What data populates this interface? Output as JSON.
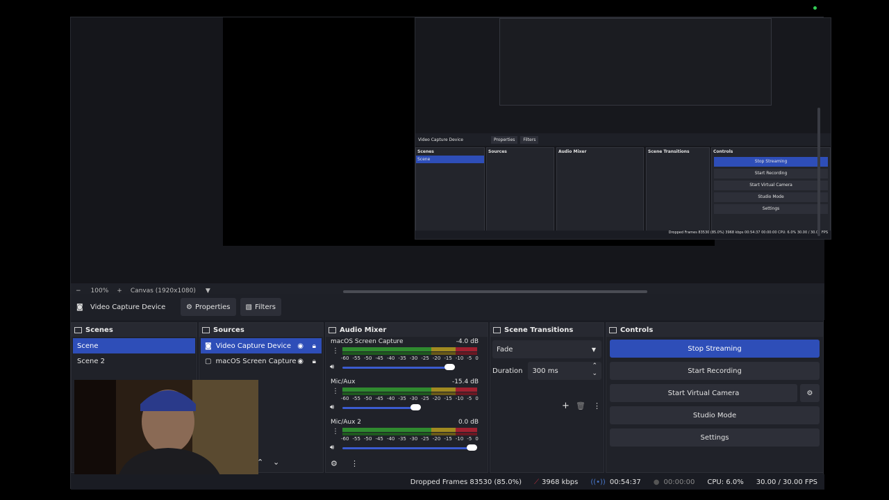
{
  "preview": {
    "zoom_minus": "−",
    "zoom_level": "100%",
    "zoom_plus": "+",
    "canvas_label": "Canvas (1920x1080)",
    "nested": {
      "source_name": "Video Capture Device",
      "properties": "Properties",
      "filters": "Filters",
      "scenes_title": "Scenes",
      "sources_title": "Sources",
      "mixer_title": "Audio Mixer",
      "transitions_title": "Scene Transitions",
      "controls_title": "Controls",
      "stop_streaming": "Stop Streaming",
      "start_recording": "Start Recording",
      "start_virtual_camera": "Start Virtual Camera",
      "studio_mode": "Studio Mode",
      "settings": "Settings",
      "status": "Dropped Frames 83530 (85.0%)   3968 kbps   00:54:37   00:00:00   CPU: 6.0%   30.00 / 30.00 FPS"
    }
  },
  "source_toolbar": {
    "source_name": "Video Capture Device",
    "properties_label": "Properties",
    "filters_label": "Filters"
  },
  "scenes": {
    "title": "Scenes",
    "items": [
      "Scene",
      "Scene 2"
    ]
  },
  "sources": {
    "title": "Sources",
    "items": [
      {
        "label": "Video Capture Device",
        "icon": "camera-icon"
      },
      {
        "label": "macOS Screen Capture",
        "icon": "monitor-icon"
      }
    ]
  },
  "audio_mixer": {
    "title": "Audio Mixer",
    "scale": [
      "-60",
      "-55",
      "-50",
      "-45",
      "-40",
      "-35",
      "-30",
      "-25",
      "-20",
      "-15",
      "-10",
      "-5",
      "0"
    ],
    "channels": [
      {
        "name": "macOS Screen Capture",
        "db": "-4.0 dB",
        "volume": 0.82
      },
      {
        "name": "Mic/Aux",
        "db": "-15.4 dB",
        "volume": 0.55
      },
      {
        "name": "Mic/Aux 2",
        "db": "0.0 dB",
        "volume": 1.0
      }
    ]
  },
  "transitions": {
    "title": "Scene Transitions",
    "selected": "Fade",
    "duration_label": "Duration",
    "duration_value": "300 ms"
  },
  "controls": {
    "title": "Controls",
    "stop_streaming": "Stop Streaming",
    "start_recording": "Start Recording",
    "start_virtual_camera": "Start Virtual Camera",
    "studio_mode": "Studio Mode",
    "settings": "Settings"
  },
  "status": {
    "dropped_frames": "Dropped Frames 83530 (85.0%)",
    "bitrate": "3968 kbps",
    "stream_time": "00:54:37",
    "record_time": "00:00:00",
    "cpu": "CPU: 6.0%",
    "fps": "30.00 / 30.00 FPS"
  },
  "colors": {
    "accent": "#2e4eb8",
    "meter_green": "#2f8a2f",
    "meter_yellow": "#a08a20",
    "meter_red": "#a02030"
  }
}
